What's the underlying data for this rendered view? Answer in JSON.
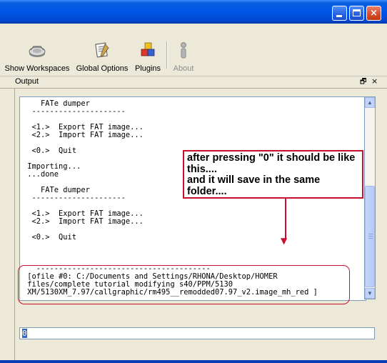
{
  "window": {
    "minimize_label": "minimize",
    "maximize_label": "maximize",
    "close_label": "×"
  },
  "toolbar": {
    "items": [
      {
        "label": "Show Workspaces",
        "icon": "workspaces-icon",
        "enabled": true
      },
      {
        "label": "Global Options",
        "icon": "options-icon",
        "enabled": true
      },
      {
        "label": "Plugins",
        "icon": "plugins-icon",
        "enabled": true
      },
      {
        "label": "About",
        "icon": "about-icon",
        "enabled": false
      }
    ]
  },
  "panel": {
    "title": "Output",
    "float_glyph": "🗗",
    "close_glyph": "×"
  },
  "console": {
    "text": "    FATe dumper\n  ---------------------\n\n  <1.>  Export FAT image...\n  <2.>  Import FAT image...\n\n  <0.>  Quit\n\n Importing...\n ...done\n\n    FATe dumper\n  ---------------------\n\n  <1.>  Export FAT image...\n  <2.>  Import FAT image...\n\n  <0.>  Quit\n\n\n\n   ---------------------------------------\n [ofile #0: C:/Documents and Settings/RHONA/Desktop/HOMER\n files/complete tutorial modifying s40/PPM/5130\n XM/5130XM_7.97/callgraphic/rm495__remodded07.97_v2.image_mh_red ]"
  },
  "annotation": {
    "text": "after pressing \"0\" it should be like this....\nand it will save in the same folder....",
    "color": "#c8102e"
  },
  "input": {
    "value": "0"
  },
  "colors": {
    "titlebar": "#0055e5",
    "chrome": "#ece9d8",
    "accent_red": "#c8102e"
  }
}
